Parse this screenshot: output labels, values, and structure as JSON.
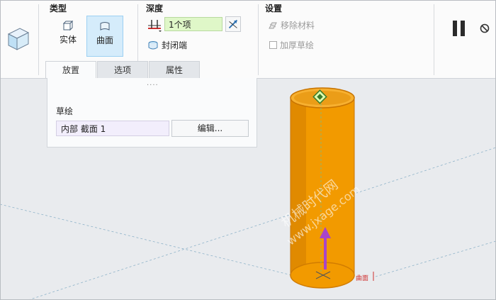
{
  "ribbon": {
    "type_group": {
      "title": "类型",
      "solid_label": "实体",
      "surface_label": "曲面",
      "selected": "曲面"
    },
    "depth_group": {
      "title": "深度",
      "depth_value": "1个项",
      "capped_label": "封闭端"
    },
    "settings_group": {
      "title": "设置",
      "remove_material_label": "移除材料",
      "thicken_label": "加厚草绘"
    }
  },
  "tabs": [
    {
      "label": "放置",
      "active": true
    },
    {
      "label": "选项",
      "active": false
    },
    {
      "label": "属性",
      "active": false
    }
  ],
  "placement_panel": {
    "grip": "....",
    "sketch_label": "草绘",
    "sketch_value": "内部 截面 1",
    "edit_label": "编辑..."
  },
  "viewport": {
    "surface_tag": "曲面",
    "watermark_line1": "机械时代网",
    "watermark_line2": "www.jxage.com"
  },
  "colors": {
    "cylinder": "#f29a00",
    "cylinder_edge": "#c87400",
    "direction_arrow": "#a845c8",
    "active_type": "#d5ecfb",
    "depth_field": "#dff7c8"
  }
}
